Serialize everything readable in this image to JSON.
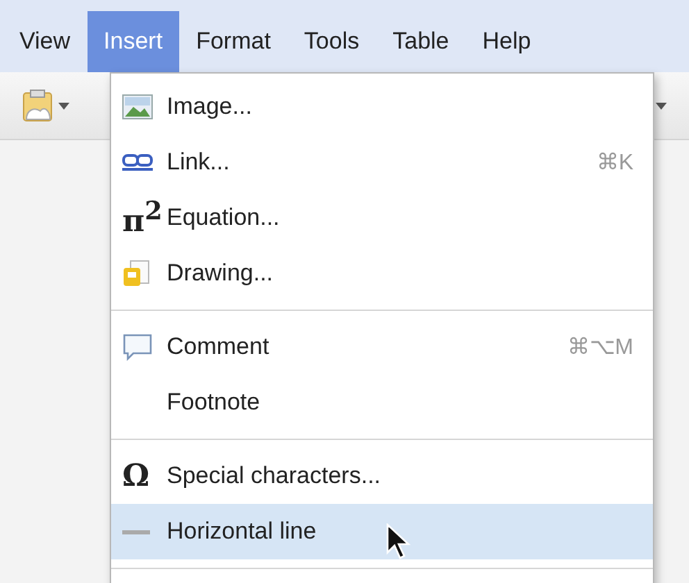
{
  "menu_bar": [
    {
      "label": "View",
      "selected": false
    },
    {
      "label": "Insert",
      "selected": true
    },
    {
      "label": "Format",
      "selected": false
    },
    {
      "label": "Tools",
      "selected": false
    },
    {
      "label": "Table",
      "selected": false
    },
    {
      "label": "Help",
      "selected": false
    }
  ],
  "insert_menu": {
    "groups": [
      [
        {
          "kind": "image",
          "label": "Image...",
          "selected": false
        },
        {
          "kind": "link",
          "label": "Link...",
          "shortcut": "⌘K",
          "selected": false
        },
        {
          "kind": "equation",
          "glyph": "π$^{2}$",
          "label": "Equation...",
          "selected": false
        },
        {
          "kind": "drawing",
          "label": "Drawing...",
          "selected": false
        }
      ],
      [
        {
          "kind": "comment",
          "label": "Comment",
          "shortcut": "⌘⌥M",
          "selected": false
        },
        {
          "kind": "none",
          "label": "Footnote",
          "selected": false
        }
      ],
      [
        {
          "kind": "special",
          "glyph": "Ω",
          "label": "Special characters...",
          "selected": false
        },
        {
          "kind": "hline",
          "label": "Horizontal line",
          "selected": true
        }
      ]
    ]
  }
}
